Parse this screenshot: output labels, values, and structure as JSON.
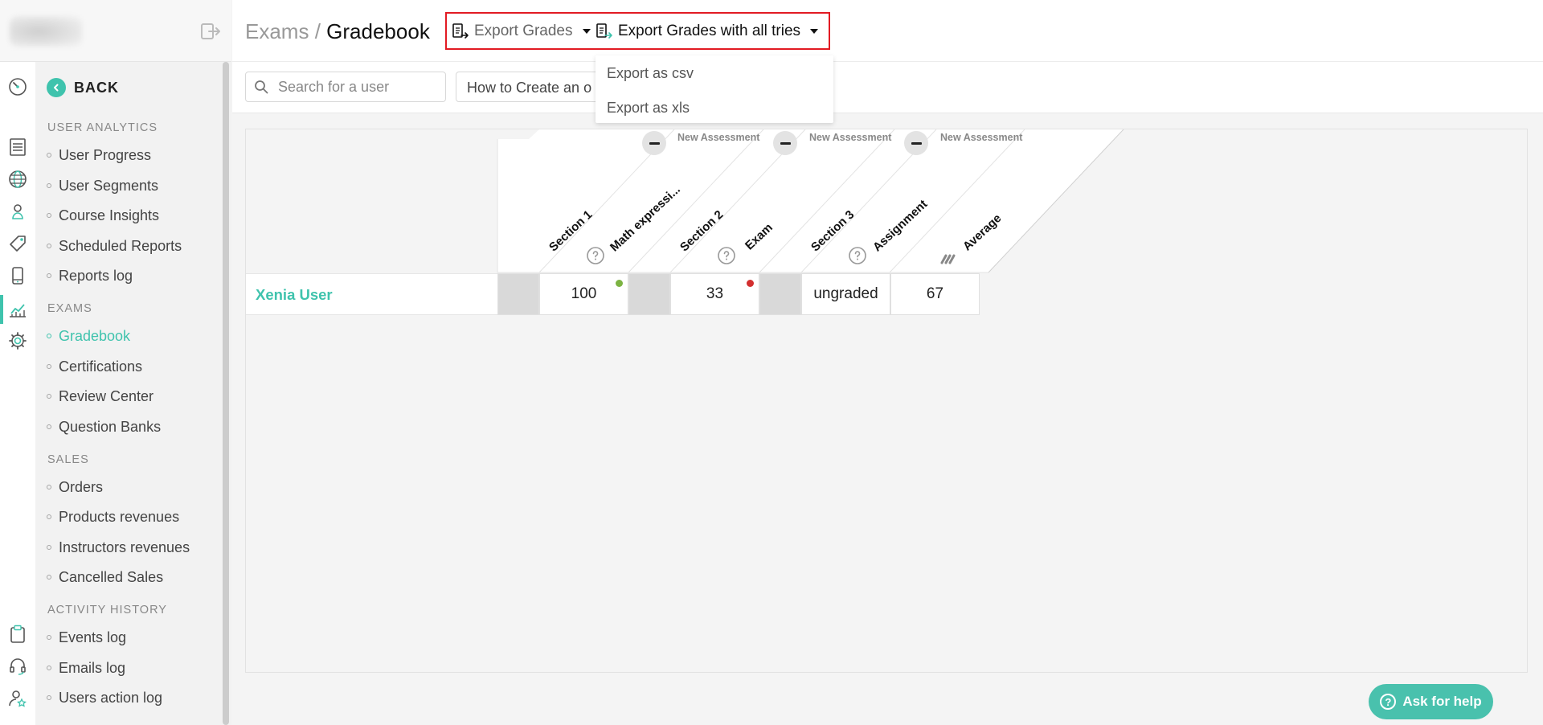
{
  "sidebar": {
    "back_label": "BACK",
    "sections": [
      {
        "title": "USER ANALYTICS",
        "items": [
          "User Progress",
          "User Segments",
          "Course Insights",
          "Scheduled Reports",
          "Reports log"
        ]
      },
      {
        "title": "EXAMS",
        "items": [
          "Gradebook",
          "Certifications",
          "Review Center",
          "Question Banks"
        ]
      },
      {
        "title": "SALES",
        "items": [
          "Orders",
          "Products revenues",
          "Instructors revenues",
          "Cancelled Sales"
        ]
      },
      {
        "title": "ACTIVITY HISTORY",
        "items": [
          "Events log",
          "Emails log",
          "Users action log"
        ]
      }
    ],
    "active_item": "Gradebook",
    "rail_icons": [
      "speedometer-icon",
      "list-icon",
      "globe-icon",
      "user-pin-icon",
      "tag-icon",
      "mobile-icon",
      "chart-icon",
      "gear-icon",
      "clipboard-icon",
      "headset-icon",
      "user-star-icon"
    ],
    "accent_color": "#3fc3ad"
  },
  "header": {
    "breadcrumb_parent": "Exams",
    "breadcrumb_sep": "/",
    "breadcrumb_current": "Gradebook",
    "export_grades_label": "Export Grades",
    "export_all_tries_label": "Export Grades with all tries",
    "highlight_color": "#e21b23"
  },
  "dropdown": {
    "items": [
      "Export as csv",
      "Export as xls"
    ]
  },
  "filters": {
    "search_placeholder": "Search for a user",
    "course_select_value": "How to Create an o"
  },
  "gradebook": {
    "columns": [
      {
        "label": "Section 1",
        "type": "section"
      },
      {
        "label": "Math expressi...",
        "type": "assessment",
        "assessment_label": "New Assessment"
      },
      {
        "label": "Section 2",
        "type": "section"
      },
      {
        "label": "Exam",
        "type": "assessment",
        "assessment_label": "New Assessment"
      },
      {
        "label": "Section 3",
        "type": "section"
      },
      {
        "label": "Assignment",
        "type": "assessment",
        "assessment_label": "New Assessment"
      },
      {
        "label": "Average",
        "type": "average"
      }
    ],
    "rows": [
      {
        "user": "Xenia User",
        "grades": [
          "",
          "100",
          "",
          "33",
          "",
          "ungraded",
          "67"
        ],
        "status_colors": [
          "",
          "#7cb342",
          "",
          "#d32f2f",
          "",
          "",
          ""
        ]
      }
    ]
  },
  "help": {
    "label": "Ask for help"
  }
}
